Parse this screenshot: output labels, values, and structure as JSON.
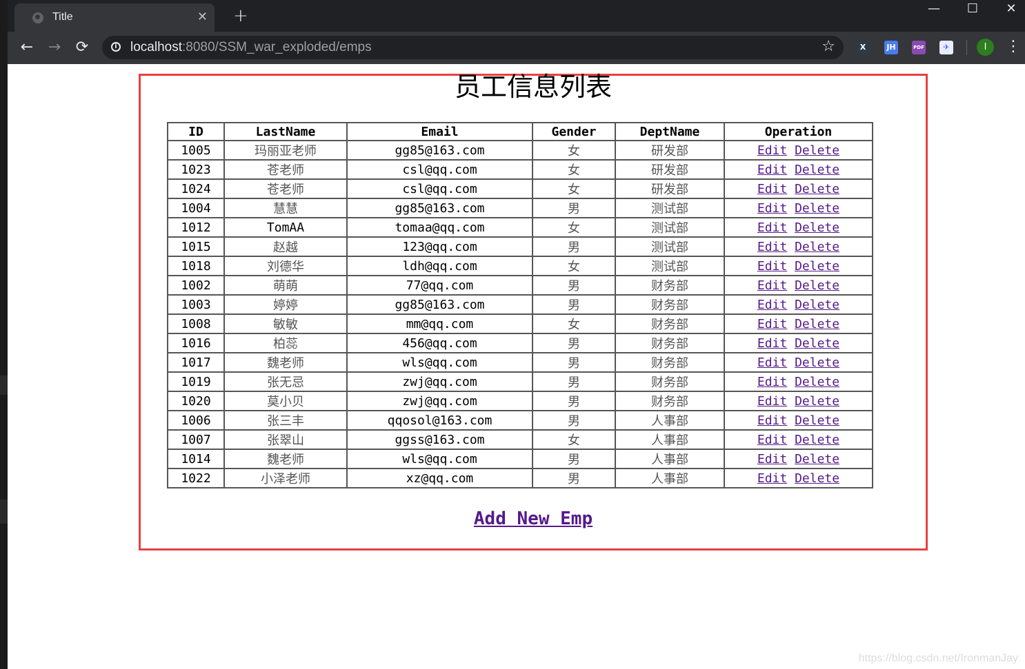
{
  "browser": {
    "tab_title": "Title",
    "url_host": "localhost",
    "url_path": ":8080/SSM_war_exploded/emps",
    "window_controls": {
      "minimize": "—",
      "maximize": "☐",
      "close": "✕"
    },
    "extensions": [
      {
        "name": "x-extension",
        "label": "X",
        "bg": "#2b3a45",
        "fg": "#ffffff"
      },
      {
        "name": "jh-extension",
        "label": "JH",
        "bg": "#4a7cf0",
        "fg": "#ffffff"
      },
      {
        "name": "pdf-extension",
        "label": "PDF",
        "bg": "#8a4bb0",
        "fg": "#ffffff"
      },
      {
        "name": "bird-extension",
        "label": "✈",
        "bg": "#e8ecff",
        "fg": "#4a5cf0"
      }
    ],
    "profile_initial": "I"
  },
  "page": {
    "title": "员工信息列表",
    "columns": [
      "ID",
      "LastName",
      "Email",
      "Gender",
      "DeptName",
      "Operation"
    ],
    "edit_label": "Edit",
    "delete_label": "Delete",
    "rows": [
      {
        "id": "1005",
        "last_name": "玛丽亚老师",
        "email": "gg85@163.com",
        "gender": "女",
        "dept": "研发部"
      },
      {
        "id": "1023",
        "last_name": "苍老师",
        "email": "csl@qq.com",
        "gender": "女",
        "dept": "研发部"
      },
      {
        "id": "1024",
        "last_name": "苍老师",
        "email": "csl@qq.com",
        "gender": "女",
        "dept": "研发部"
      },
      {
        "id": "1004",
        "last_name": "慧慧",
        "email": "gg85@163.com",
        "gender": "男",
        "dept": "测试部"
      },
      {
        "id": "1012",
        "last_name": "TomAA",
        "email": "tomaa@qq.com",
        "gender": "女",
        "dept": "测试部"
      },
      {
        "id": "1015",
        "last_name": "赵越",
        "email": "123@qq.com",
        "gender": "男",
        "dept": "测试部"
      },
      {
        "id": "1018",
        "last_name": "刘德华",
        "email": "ldh@qq.com",
        "gender": "女",
        "dept": "测试部"
      },
      {
        "id": "1002",
        "last_name": "萌萌",
        "email": "77@qq.com",
        "gender": "男",
        "dept": "财务部"
      },
      {
        "id": "1003",
        "last_name": "婷婷",
        "email": "gg85@163.com",
        "gender": "男",
        "dept": "财务部"
      },
      {
        "id": "1008",
        "last_name": "敏敏",
        "email": "mm@qq.com",
        "gender": "女",
        "dept": "财务部"
      },
      {
        "id": "1016",
        "last_name": "柏蕊",
        "email": "456@qq.com",
        "gender": "男",
        "dept": "财务部"
      },
      {
        "id": "1017",
        "last_name": "魏老师",
        "email": "wls@qq.com",
        "gender": "男",
        "dept": "财务部"
      },
      {
        "id": "1019",
        "last_name": "张无忌",
        "email": "zwj@qq.com",
        "gender": "男",
        "dept": "财务部"
      },
      {
        "id": "1020",
        "last_name": "莫小贝",
        "email": "zwj@qq.com",
        "gender": "男",
        "dept": "财务部"
      },
      {
        "id": "1006",
        "last_name": "张三丰",
        "email": "qqosol@163.com",
        "gender": "男",
        "dept": "人事部"
      },
      {
        "id": "1007",
        "last_name": "张翠山",
        "email": "ggss@163.com",
        "gender": "女",
        "dept": "人事部"
      },
      {
        "id": "1014",
        "last_name": "魏老师",
        "email": "wls@qq.com",
        "gender": "男",
        "dept": "人事部"
      },
      {
        "id": "1022",
        "last_name": "小泽老师",
        "email": "xz@qq.com",
        "gender": "男",
        "dept": "人事部"
      }
    ],
    "add_link": "Add New Emp",
    "frame_color": "#e84040",
    "link_color": "#551a8b"
  },
  "watermark": "https://blog.csdn.net/IronmanJay"
}
